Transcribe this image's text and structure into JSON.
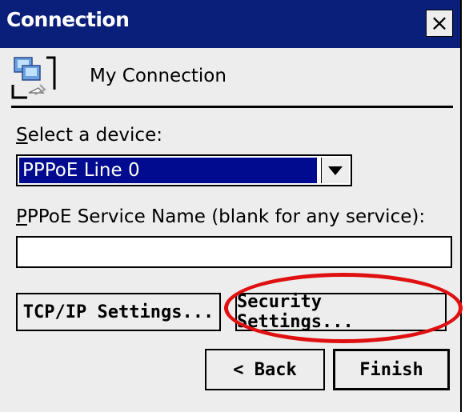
{
  "window": {
    "title": "Connection",
    "close_label": "×"
  },
  "connection": {
    "name": "My Connection",
    "icon": "network-connection-icon"
  },
  "device": {
    "label": "Select a device:",
    "selected": "PPPoE Line 0"
  },
  "service": {
    "label": "PPPoE Service Name (blank for any service):",
    "value": ""
  },
  "buttons": {
    "tcpip": "TCP/IP Settings...",
    "security": "Security Settings...",
    "back": "< Back",
    "finish": "Finish"
  },
  "colors": {
    "titlebar": "#0a1f7a",
    "selection": "#000b8f",
    "highlight_oval": "#e01010",
    "dialog_bg": "#ededed"
  }
}
